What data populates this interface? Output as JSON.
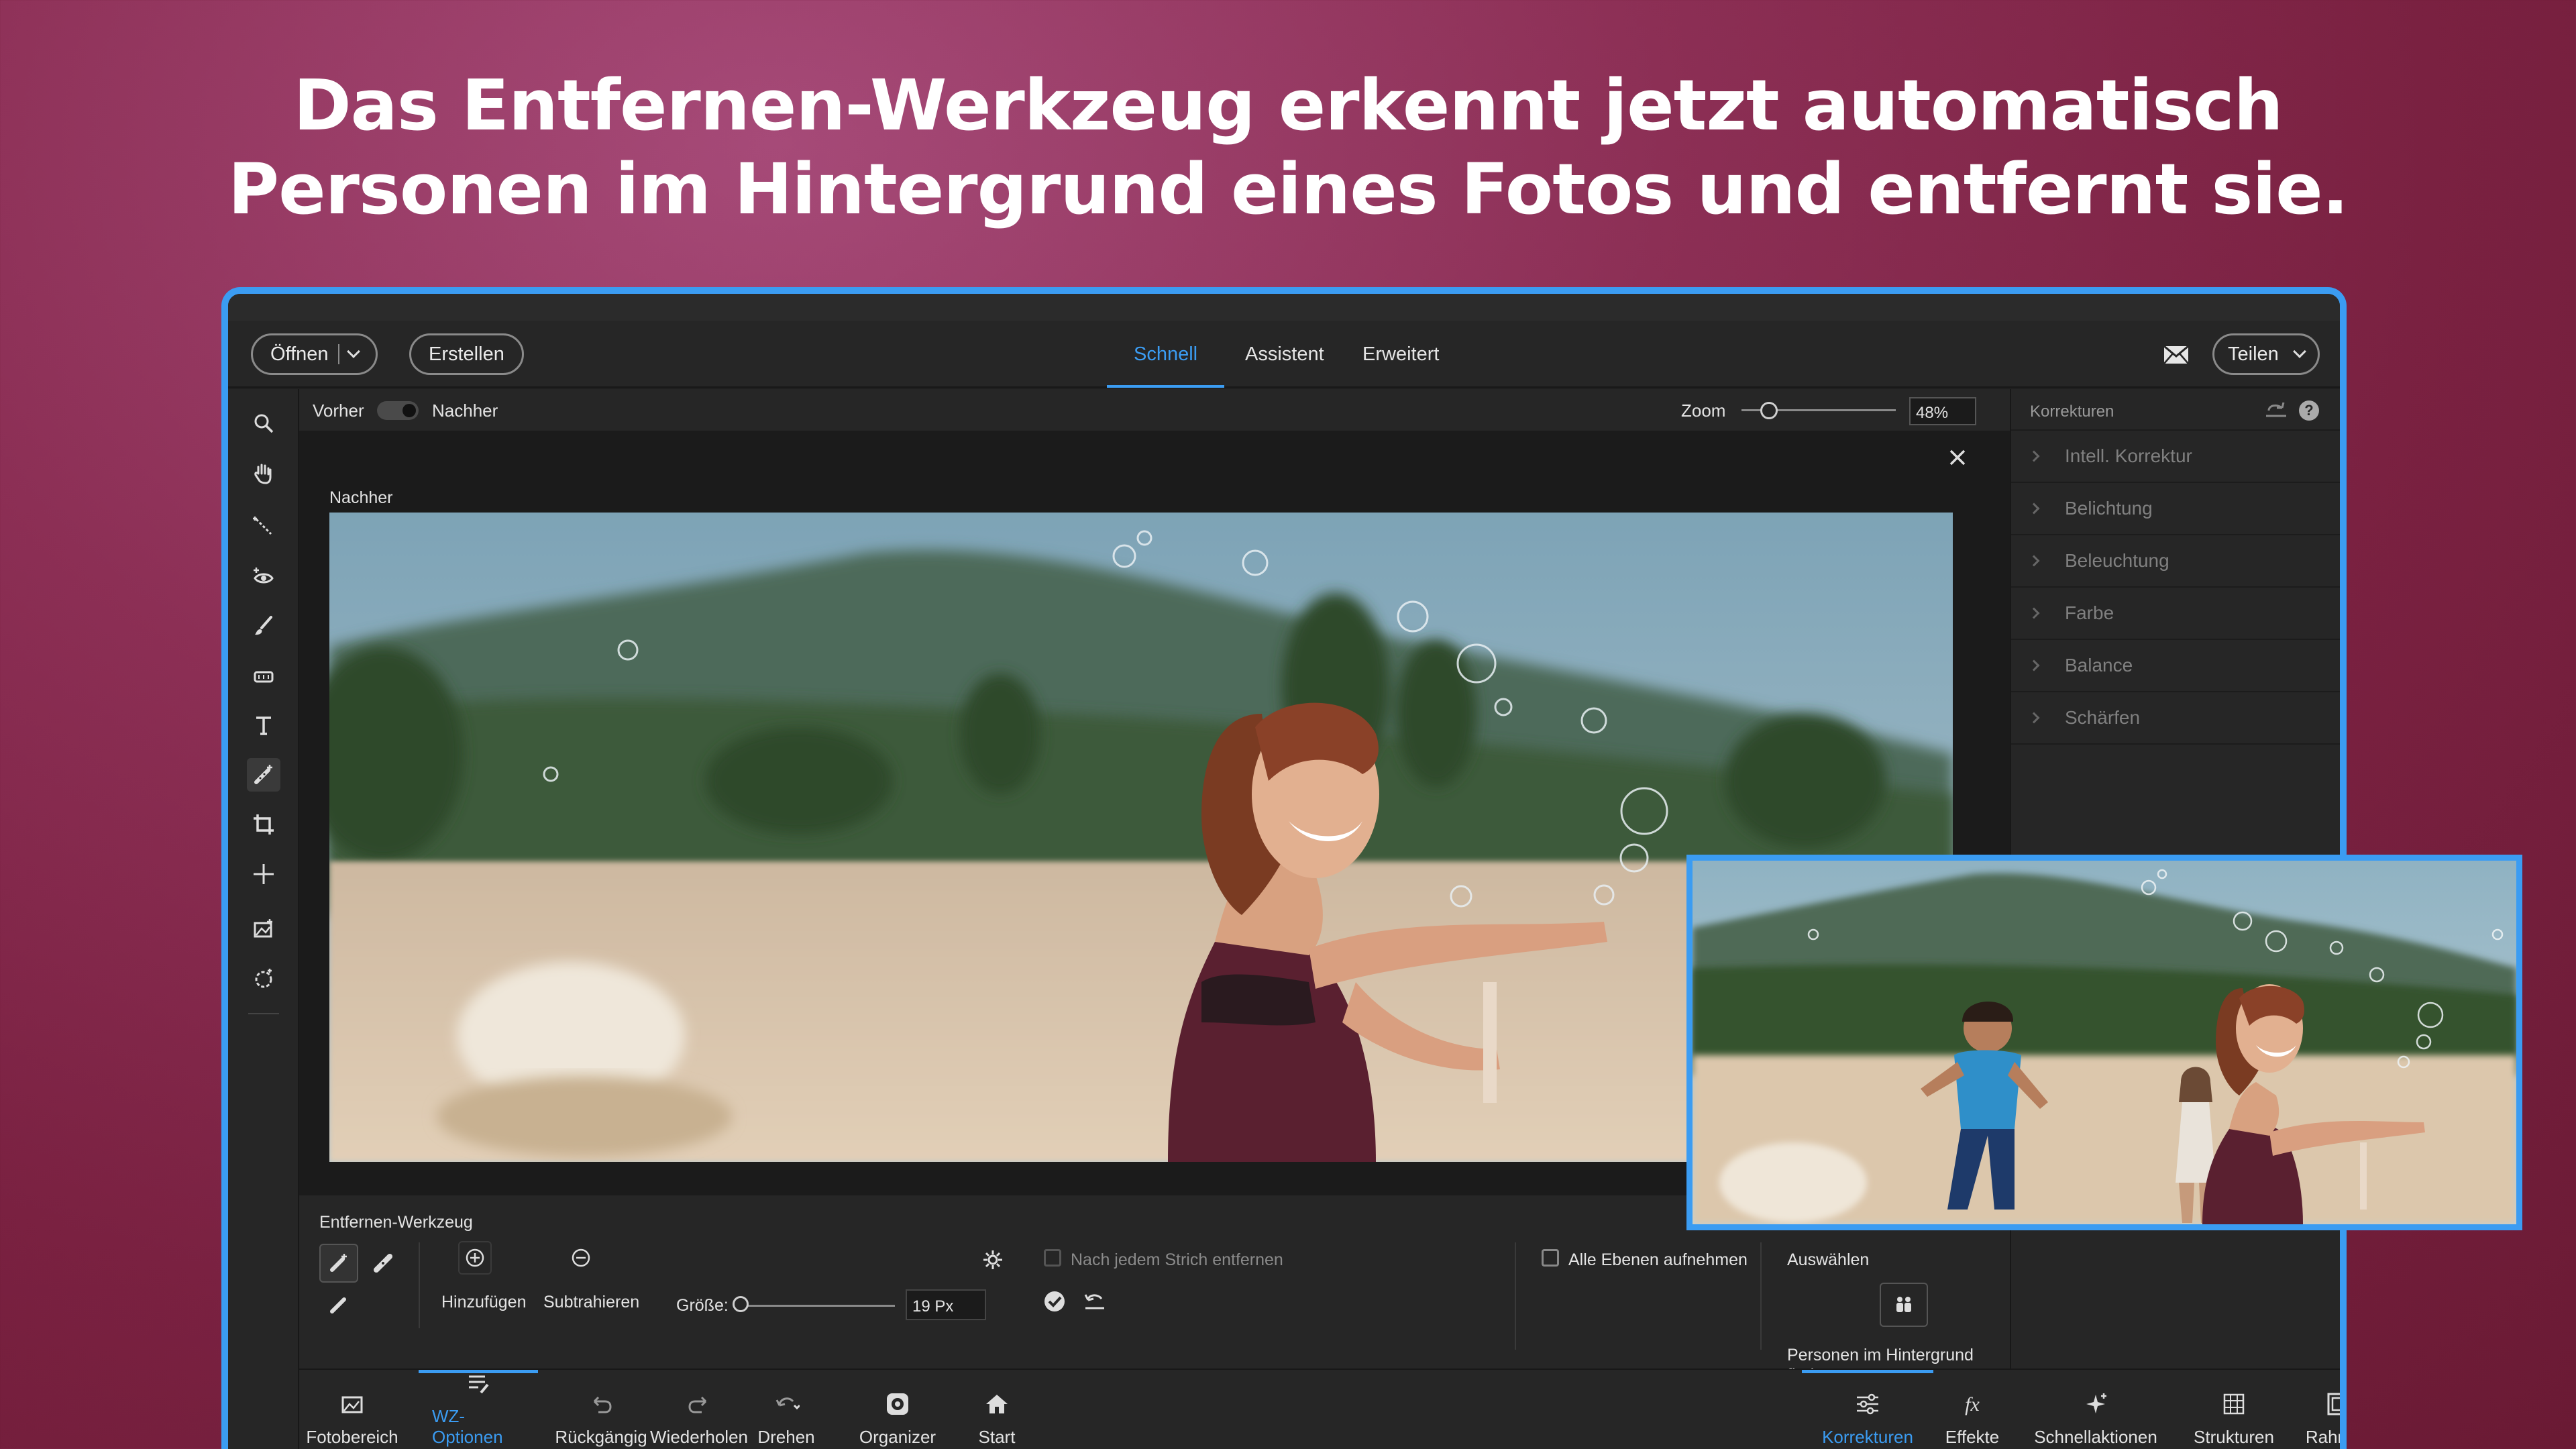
{
  "headline": {
    "line1": "Das Entfernen-Werkzeug erkennt jetzt automatisch",
    "line2": "Personen im Hintergrund eines Fotos und entfernt sie."
  },
  "menubar": {
    "open_label": "Öffnen",
    "create_label": "Erstellen",
    "tabs": [
      "Schnell",
      "Assistent",
      "Erweitert"
    ],
    "active_tab": "Schnell",
    "share_label": "Teilen"
  },
  "viewbar": {
    "before_label": "Vorher",
    "after_label": "Nachher",
    "zoom_label": "Zoom",
    "zoom_value": "48%"
  },
  "canvas": {
    "view_label": "Nachher"
  },
  "right_panel": {
    "title": "Korrekturen",
    "items": [
      "Intell. Korrektur",
      "Belichtung",
      "Beleuchtung",
      "Farbe",
      "Balance",
      "Schärfen"
    ]
  },
  "tool_options": {
    "title": "Entfernen-Werkzeug",
    "add_label": "Hinzufügen",
    "subtract_label": "Subtrahieren",
    "size_label": "Größe:",
    "size_value": "19 Px",
    "remove_after_stroke": "Nach jedem Strich entfernen",
    "sample_all_layers": "Alle Ebenen aufnehmen",
    "select_label": "Auswählen",
    "find_people_label": "Personen im Hintergrund finden"
  },
  "bottom_bar": {
    "left": [
      {
        "label": "Fotobereich",
        "icon": "photo-bin-icon"
      },
      {
        "label": "WZ-Optionen",
        "icon": "tool-options-icon",
        "active": true
      },
      {
        "label": "Rückgängig",
        "icon": "undo-icon"
      },
      {
        "label": "Wiederholen",
        "icon": "redo-icon"
      },
      {
        "label": "Drehen",
        "icon": "rotate-icon"
      },
      {
        "label": "Organizer",
        "icon": "organizer-icon"
      },
      {
        "label": "Start",
        "icon": "home-icon"
      }
    ],
    "right": [
      {
        "label": "Korrekturen",
        "icon": "adjustments-icon",
        "active": true
      },
      {
        "label": "Effekte",
        "icon": "fx-icon"
      },
      {
        "label": "Schnellaktionen",
        "icon": "sparkle-icon"
      },
      {
        "label": "Strukturen",
        "icon": "textures-icon"
      },
      {
        "label": "Rahmen",
        "icon": "frames-icon"
      }
    ]
  },
  "colors": {
    "accent": "#3b9cf2",
    "background": "#8c2f55",
    "app_bg": "#1f1f1f",
    "panel_bg": "#262626"
  }
}
